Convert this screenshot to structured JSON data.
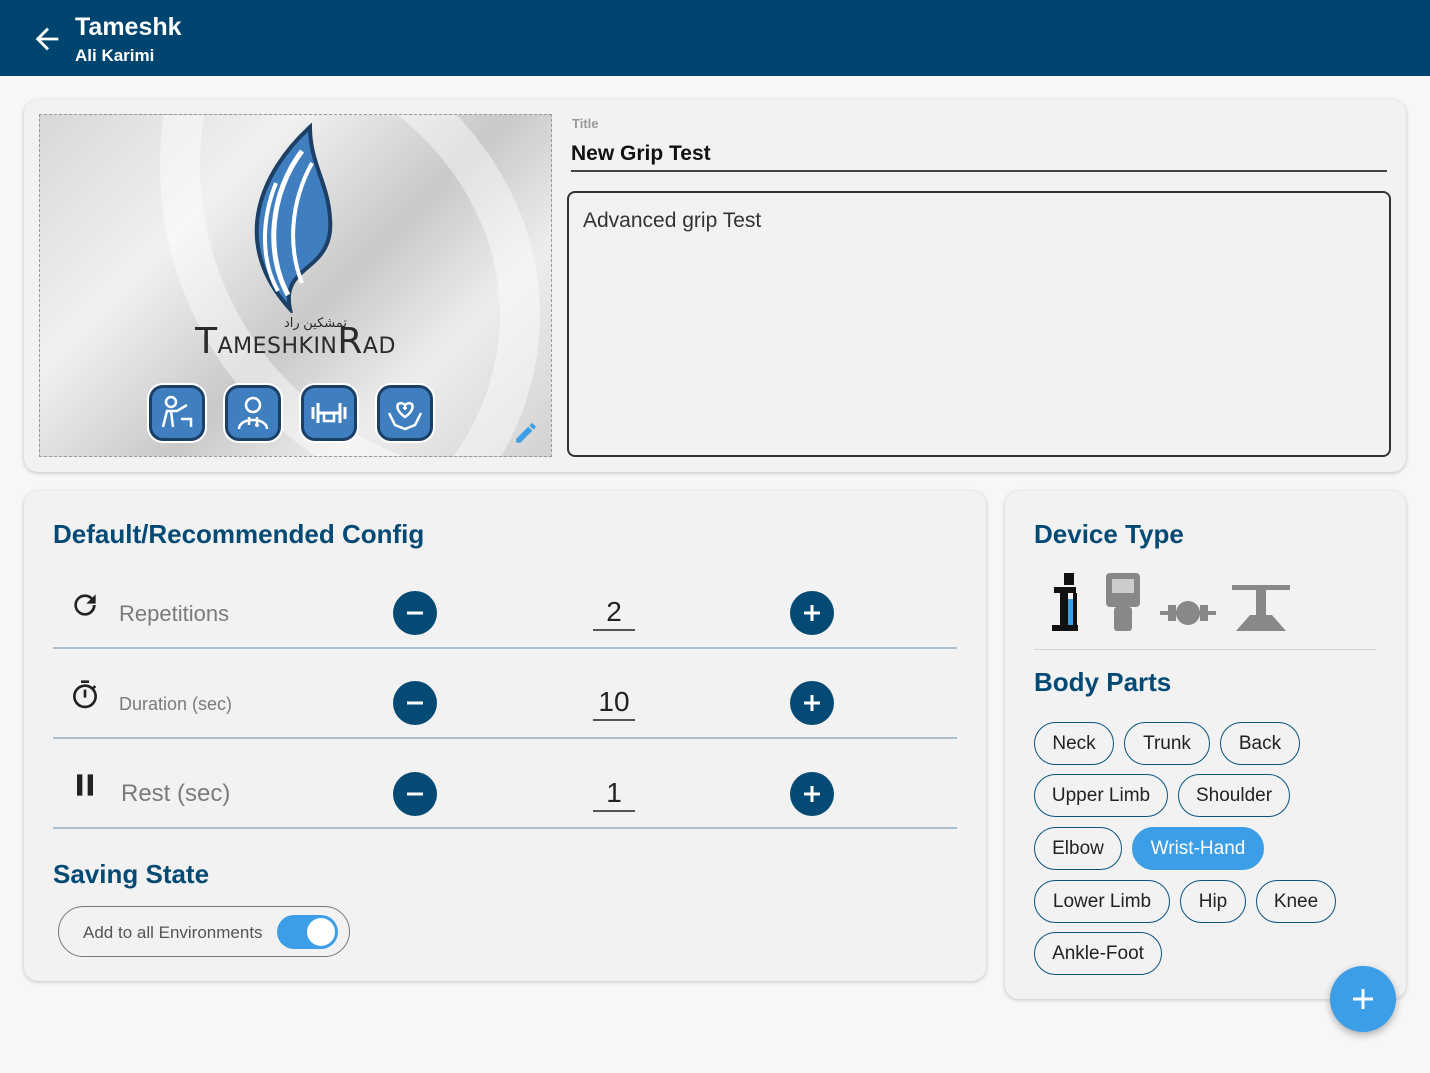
{
  "header": {
    "title": "Tameshk",
    "subtitle": "Ali Karimi",
    "back_icon": "arrow-left-icon"
  },
  "test": {
    "title_label": "Title",
    "title_value": "New Grip Test",
    "description_value": "Advanced grip Test"
  },
  "logo": {
    "persian_text": "تمشکین راد",
    "brand_text_parts": [
      "T",
      "AMESHKIN",
      "R",
      "AD"
    ],
    "icons": [
      "fitness-trainer-icon",
      "doctor-icon",
      "dumbbell-icon",
      "heart-hands-icon"
    ]
  },
  "config": {
    "title": "Default/Recommended Config",
    "rows": [
      {
        "label": "Repetitions",
        "value": "2",
        "icon": "refresh-icon"
      },
      {
        "label": "Duration (sec)",
        "value": "10",
        "icon": "stopwatch-icon"
      },
      {
        "label": "Rest (sec)",
        "value": "1",
        "icon": "pause-icon"
      }
    ]
  },
  "saving": {
    "title": "Saving State",
    "toggle_label": "Add to all Environments",
    "toggle_on": true
  },
  "device": {
    "title": "Device Type",
    "icons": [
      "vertical-dynamometer-icon",
      "handheld-dynamometer-icon",
      "pinch-gauge-icon",
      "platform-dynamometer-icon"
    ]
  },
  "body_parts": {
    "title": "Body Parts",
    "chips": [
      {
        "label": "Neck",
        "selected": false
      },
      {
        "label": "Trunk",
        "selected": false
      },
      {
        "label": "Back",
        "selected": false
      },
      {
        "label": "Upper Limb",
        "selected": false
      },
      {
        "label": "Shoulder",
        "selected": false
      },
      {
        "label": "Elbow",
        "selected": false
      },
      {
        "label": "Wrist-Hand",
        "selected": true
      },
      {
        "label": "Lower Limb",
        "selected": false
      },
      {
        "label": "Hip",
        "selected": false
      },
      {
        "label": "Knee",
        "selected": false
      },
      {
        "label": "Ankle-Foot",
        "selected": false
      }
    ]
  },
  "colors": {
    "primary": "#00456f",
    "accent": "#3b9ee6",
    "chip_border": "#0b5480"
  }
}
